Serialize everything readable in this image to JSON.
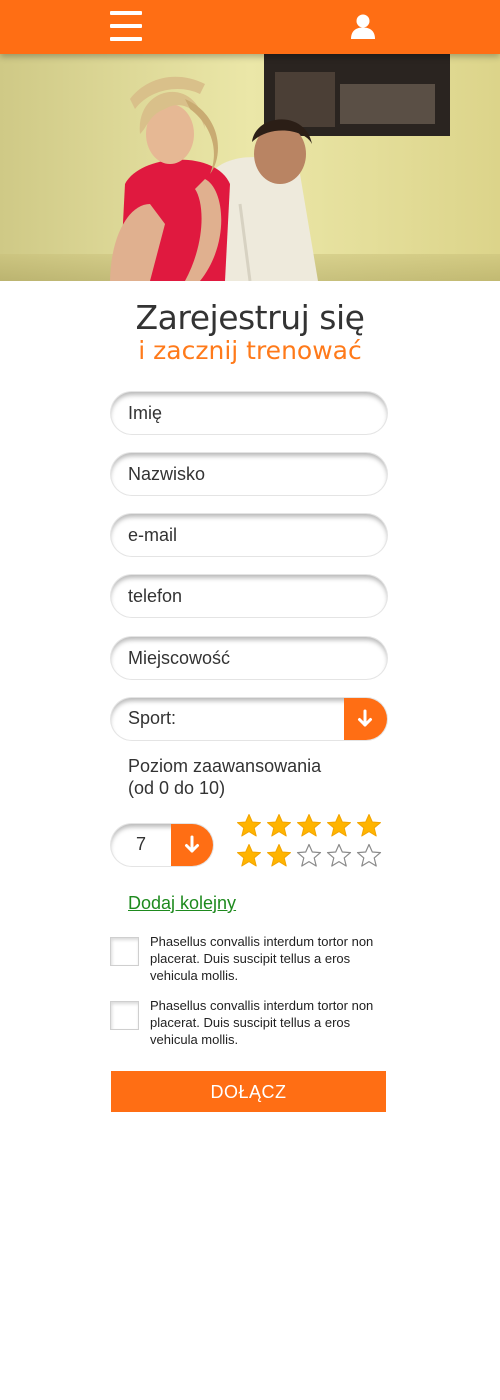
{
  "header": {
    "menu_icon": "hamburger-menu-icon",
    "user_icon": "user-icon",
    "accent_color": "#ff6e14"
  },
  "hero": {
    "image": "photo of dancing couple"
  },
  "headline": {
    "title": "Zarejestruj się",
    "subtitle": "i zacznij trenować"
  },
  "form": {
    "first_name_placeholder": "Imię",
    "last_name_placeholder": "Nazwisko",
    "email_placeholder": "e-mail",
    "phone_placeholder": "telefon",
    "city_placeholder": "Miejscowość",
    "sport_label": "Sport:",
    "level_label_line1": "Poziom zaawansowania",
    "level_label_line2": "(od 0 do 10)",
    "level_value": "7",
    "rating": {
      "filled": 7,
      "total": 10
    },
    "add_another": "Dodaj kolejny",
    "consents": [
      {
        "text": "Phasellus convallis interdum tortor non placerat. Duis suscipit tellus a eros vehicula mollis.",
        "checked": false
      },
      {
        "text": "Phasellus convallis interdum tortor non placerat. Duis suscipit tellus a eros vehicula mollis.",
        "checked": false
      }
    ],
    "submit_label": "DOŁĄCZ"
  }
}
